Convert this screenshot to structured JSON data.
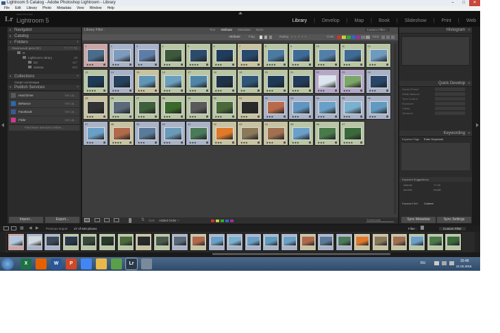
{
  "window": {
    "title": "Lightroom 5 Catalog - Adobe Photoshop Lightroom - Library"
  },
  "menu": [
    "File",
    "Edit",
    "Library",
    "Photo",
    "Metadata",
    "View",
    "Window",
    "Help"
  ],
  "identity": {
    "mark": "Lr",
    "subtitle": "Adobe Photoshop",
    "product": "Lightroom 5"
  },
  "modules": [
    "Library",
    "Develop",
    "Map",
    "Book",
    "Slideshow",
    "Print",
    "Web"
  ],
  "modules_active": "Library",
  "left_panel": {
    "navigator": "Navigator",
    "catalog": "Catalog",
    "folders": "Folders",
    "volume": {
      "label": "Локальный диск (D:)",
      "info": "?? / ?? ГБ"
    },
    "folder_rows": [
      {
        "label": "D:",
        "count": "",
        "indent": 8
      },
      {
        "label": "Lightroom Library",
        "count": "39",
        "indent": 16
      },
      {
        "label": "D3",
        "count": "427",
        "indent": 24
      },
      {
        "label": "папкаа",
        "count": "640",
        "indent": 24
      }
    ],
    "collections": "Collections",
    "collection_row": "Смарт коллекции",
    "publish_services": "Publish Services",
    "services": [
      {
        "name": "Hard Drive",
        "status": "Set Up...",
        "color": "#5a5a5a"
      },
      {
        "name": "Behance",
        "status": "Set Up...",
        "color": "#2a6ab0"
      },
      {
        "name": "Facebook",
        "status": "Set Up...",
        "color": "#3b5998"
      },
      {
        "name": "Flickr",
        "status": "Set Up...",
        "color": "#d03a8a"
      }
    ],
    "find_more": "Find More Services Online...",
    "import_label": "Import...",
    "export_label": "Export..."
  },
  "filter_bar": {
    "title": "Library Filter :",
    "tabs": [
      "Text",
      "Attribute",
      "Metadata",
      "None"
    ],
    "active_tab": "Attribute",
    "custom_filter": "Custom Filter ÷",
    "attribute_label": "Attribute",
    "flag_label": "Flag",
    "rating_label": "Rating",
    "color_label": "Color",
    "kind_label": "Kind"
  },
  "grid": {
    "rows": [
      [
        {
          "n": "1",
          "bg": "#c9a6a6",
          "img": "#4a6b8a",
          "stars": "★★★"
        },
        {
          "n": "2",
          "bg": "#a9b3c8",
          "img": "#7d9bbf",
          "stars": "★★★"
        },
        {
          "n": "3",
          "bg": "#a9b3c8",
          "img": "#5d7da8",
          "stars": "★★"
        },
        {
          "n": "4",
          "bg": "#b8c6a4",
          "img": "#3c5a3a",
          "stars": "★★★"
        },
        {
          "n": "5",
          "bg": "#b8c6a4",
          "img": "#2c4a6a",
          "stars": "★★★★"
        },
        {
          "n": "6",
          "bg": "#b8c6a4",
          "img": "#1f3c5c",
          "stars": "★★★"
        },
        {
          "n": "7",
          "bg": "#c7c3a0",
          "img": "#28486c",
          "stars": "★★★"
        },
        {
          "n": "8",
          "bg": "#b8c6a4",
          "img": "#4a7aa0",
          "stars": "★★★★"
        },
        {
          "n": "9",
          "bg": "#b8c6a4",
          "img": "#3d6b95",
          "stars": "★★★"
        },
        {
          "n": "10",
          "bg": "#b8c6a4",
          "img": "#527fa8",
          "stars": "★★★"
        },
        {
          "n": "11",
          "bg": "#b8c6a4",
          "img": "#3d6b95",
          "stars": "★★★"
        },
        {
          "n": "12",
          "bg": "#b8c6a4",
          "img": "#6e9ac0",
          "stars": "★★★"
        }
      ],
      [
        {
          "n": "13",
          "bg": "#b8c6a4",
          "img": "#1e3a54",
          "stars": "★★★★"
        },
        {
          "n": "14",
          "bg": "#a9b3c8",
          "img": "#24425e",
          "stars": "★★★"
        },
        {
          "n": "15",
          "bg": "#c7c3a0",
          "img": "#5f95b5",
          "stars": "★★★"
        },
        {
          "n": "16",
          "bg": "#b8c6a4",
          "img": "#6aa0bd",
          "stars": "★★★"
        },
        {
          "n": "17",
          "bg": "#b8c6a4",
          "img": "#4f86a8",
          "stars": "★★★"
        },
        {
          "n": "18",
          "bg": "#b8c6a4",
          "img": "#1f3348",
          "stars": "★★★"
        },
        {
          "n": "19",
          "bg": "#b8c6a4",
          "img": "#2f5677",
          "stars": "★★"
        },
        {
          "n": "20",
          "bg": "#b8c6a4",
          "img": "#1d3b55",
          "stars": "★★★"
        },
        {
          "n": "21",
          "bg": "#b8c6a4",
          "img": "#203c5a",
          "stars": "★★★"
        },
        {
          "n": "22",
          "bg": "#b4a8c8",
          "img": "#dde6ee",
          "stars": "★★★"
        },
        {
          "n": "23",
          "bg": "#b4a8c8",
          "img": "#7aa668",
          "stars": "★★★"
        },
        {
          "n": "24",
          "bg": "#a9b3c8",
          "img": "#28466a",
          "stars": "★★★"
        }
      ],
      [
        {
          "n": "25",
          "bg": "#c7c3a0",
          "img": "#333333",
          "stars": "★★★"
        },
        {
          "n": "26",
          "bg": "#b8c6a4",
          "img": "#5a6a7a",
          "stars": "★★★"
        },
        {
          "n": "27",
          "bg": "#b8c6a4",
          "img": "#3f5f3a",
          "stars": "★★★"
        },
        {
          "n": "28",
          "bg": "#b8c6a4",
          "img": "#3a6a2a",
          "stars": "★★★"
        },
        {
          "n": "29",
          "bg": "#b8c6a4",
          "img": "#5a5a5a",
          "stars": "★★★"
        },
        {
          "n": "30",
          "bg": "#b8c6a4",
          "img": "#4a6a3a",
          "stars": "★★★"
        },
        {
          "n": "31",
          "bg": "#c7c3a0",
          "img": "#2a2a2a",
          "stars": "★★★"
        },
        {
          "n": "32",
          "bg": "#a9b3c8",
          "img": "#b86a4a",
          "stars": "★★★"
        },
        {
          "n": "33",
          "bg": "#a9b3c8",
          "img": "#5f95c0",
          "stars": "★★★"
        },
        {
          "n": "34",
          "bg": "#a9b3c8",
          "img": "#6aa0c8",
          "stars": "★★★"
        },
        {
          "n": "35",
          "bg": "#a9b3c8",
          "img": "#7ab0d0",
          "stars": "★★★"
        },
        {
          "n": "36",
          "bg": "#a9b3c8",
          "img": "#5f9ac0",
          "stars": "★★★"
        }
      ],
      [
        {
          "n": "37",
          "bg": "#a9b3c8",
          "img": "#6aa0c8",
          "stars": "★★★"
        },
        {
          "n": "38",
          "bg": "#c7c3a0",
          "img": "#b06a4a",
          "stars": "★★★★"
        },
        {
          "n": "39",
          "bg": "#a9b3c8",
          "img": "#5a7a9a",
          "stars": "★★★"
        },
        {
          "n": "40",
          "bg": "#a9b3c8",
          "img": "#6a9ab8",
          "stars": "★★★"
        },
        {
          "n": "41",
          "bg": "#a9b3c8",
          "img": "#4a7a5a",
          "stars": "★★★"
        },
        {
          "n": "42",
          "bg": "#c7c3a0",
          "img": "#e07a2a",
          "stars": "★★★"
        },
        {
          "n": "43",
          "bg": "#c7c3a0",
          "img": "#8a7a5a",
          "stars": "★★★"
        },
        {
          "n": "44",
          "bg": "#c7c3a0",
          "img": "#a07050",
          "stars": "★★★"
        },
        {
          "n": "45",
          "bg": "#b8c6a4",
          "img": "#6aa0c8",
          "stars": "★★★"
        },
        {
          "n": "46",
          "bg": "#b8c6a4",
          "img": "#4a7a4a",
          "stars": "★★★"
        },
        {
          "n": "47",
          "bg": "#b8c6a4",
          "img": "#3a6a3a",
          "stars": "★★★★"
        }
      ]
    ]
  },
  "toolbar": {
    "sort_label": "Sort:",
    "sort_value": "Added Order ÷",
    "thumbnails_label": "Thumbnails"
  },
  "right_panel": {
    "histogram": "Histogram",
    "quick_develop": "Quick Develop",
    "qd_rows": [
      "Saved Preset",
      "White Balance",
      "Tone Control",
      "Exposure",
      "Clarity",
      "Vibrance"
    ],
    "keywording": "Keywording",
    "keyword_tags_label": "Keyword Tags",
    "keyword_tags_value": "Enter Keywords",
    "keyword_suggestions": "Keyword Suggestions",
    "suggestions": [
      "Islands",
      "17:40",
      "sunrise",
      "Kwalli"
    ],
    "keyword_set_label": "Keyword Set",
    "keyword_set_value": "Custom",
    "sync_metadata": "Sync Metadata",
    "sync_settings": "Sync Settings"
  },
  "filmstrip_header": {
    "source": "Previous Import",
    "count": "47 of 640 photos",
    "filter_label": "Filter :",
    "filter_value": "Custom Filter"
  },
  "filmstrip": [
    {
      "bg": "#c9a6a6",
      "img": "#b0c8e0"
    },
    {
      "bg": "#a9b3c8",
      "img": "#d0d8e0"
    },
    {
      "bg": "#a9b3c8",
      "img": "#3a4a5a"
    },
    {
      "bg": "#b8c6a4",
      "img": "#2a3a4a"
    },
    {
      "bg": "#b8c6a4",
      "img": "#3a4a3a"
    },
    {
      "bg": "#b8c6a4",
      "img": "#2a3a2a"
    },
    {
      "bg": "#b8c6a4",
      "img": "#4a6a3a"
    },
    {
      "bg": "#c7c3a0",
      "img": "#2a2a2a"
    },
    {
      "bg": "#b8c6a4",
      "img": "#4a5a4a"
    },
    {
      "bg": "#a9b3c8",
      "img": "#5a6a7a"
    },
    {
      "bg": "#c7c3a0",
      "img": "#b06a4a"
    },
    {
      "bg": "#a9b3c8",
      "img": "#6aa0c8"
    },
    {
      "bg": "#a9b3c8",
      "img": "#7ab0d0"
    },
    {
      "bg": "#a9b3c8",
      "img": "#6aa0c8"
    },
    {
      "bg": "#a9b3c8",
      "img": "#5f9ac0"
    },
    {
      "bg": "#a9b3c8",
      "img": "#6aa0c8"
    },
    {
      "bg": "#c7c3a0",
      "img": "#b06a4a"
    },
    {
      "bg": "#a9b3c8",
      "img": "#5a7a9a"
    },
    {
      "bg": "#a9b3c8",
      "img": "#4a7a5a"
    },
    {
      "bg": "#c7c3a0",
      "img": "#e07a2a"
    },
    {
      "bg": "#c7c3a0",
      "img": "#8a7a5a"
    },
    {
      "bg": "#c7c3a0",
      "img": "#a07050"
    },
    {
      "bg": "#b8c6a4",
      "img": "#6aa0c8"
    },
    {
      "bg": "#b8c6a4",
      "img": "#4a7a4a"
    },
    {
      "bg": "#b8c6a4",
      "img": "#3a6a3a"
    }
  ],
  "taskbar": {
    "time": "15:49",
    "date": "21.02.2016",
    "lang": "RU",
    "apps": [
      {
        "name": "excel",
        "label": "X",
        "color": "#1e7145"
      },
      {
        "name": "firefox",
        "label": "",
        "color": "#e66000"
      },
      {
        "name": "word",
        "label": "W",
        "color": "#2b579a"
      },
      {
        "name": "powerpoint",
        "label": "P",
        "color": "#d24726"
      },
      {
        "name": "chrome",
        "label": "",
        "color": "#4285f4"
      },
      {
        "name": "explorer",
        "label": "",
        "color": "#e8b84a"
      },
      {
        "name": "utility",
        "label": "",
        "color": "#5aa04a"
      },
      {
        "name": "lightroom",
        "label": "Lr",
        "color": "#2a3a4a"
      },
      {
        "name": "misc",
        "label": "",
        "color": "#7a8a9a"
      }
    ]
  }
}
